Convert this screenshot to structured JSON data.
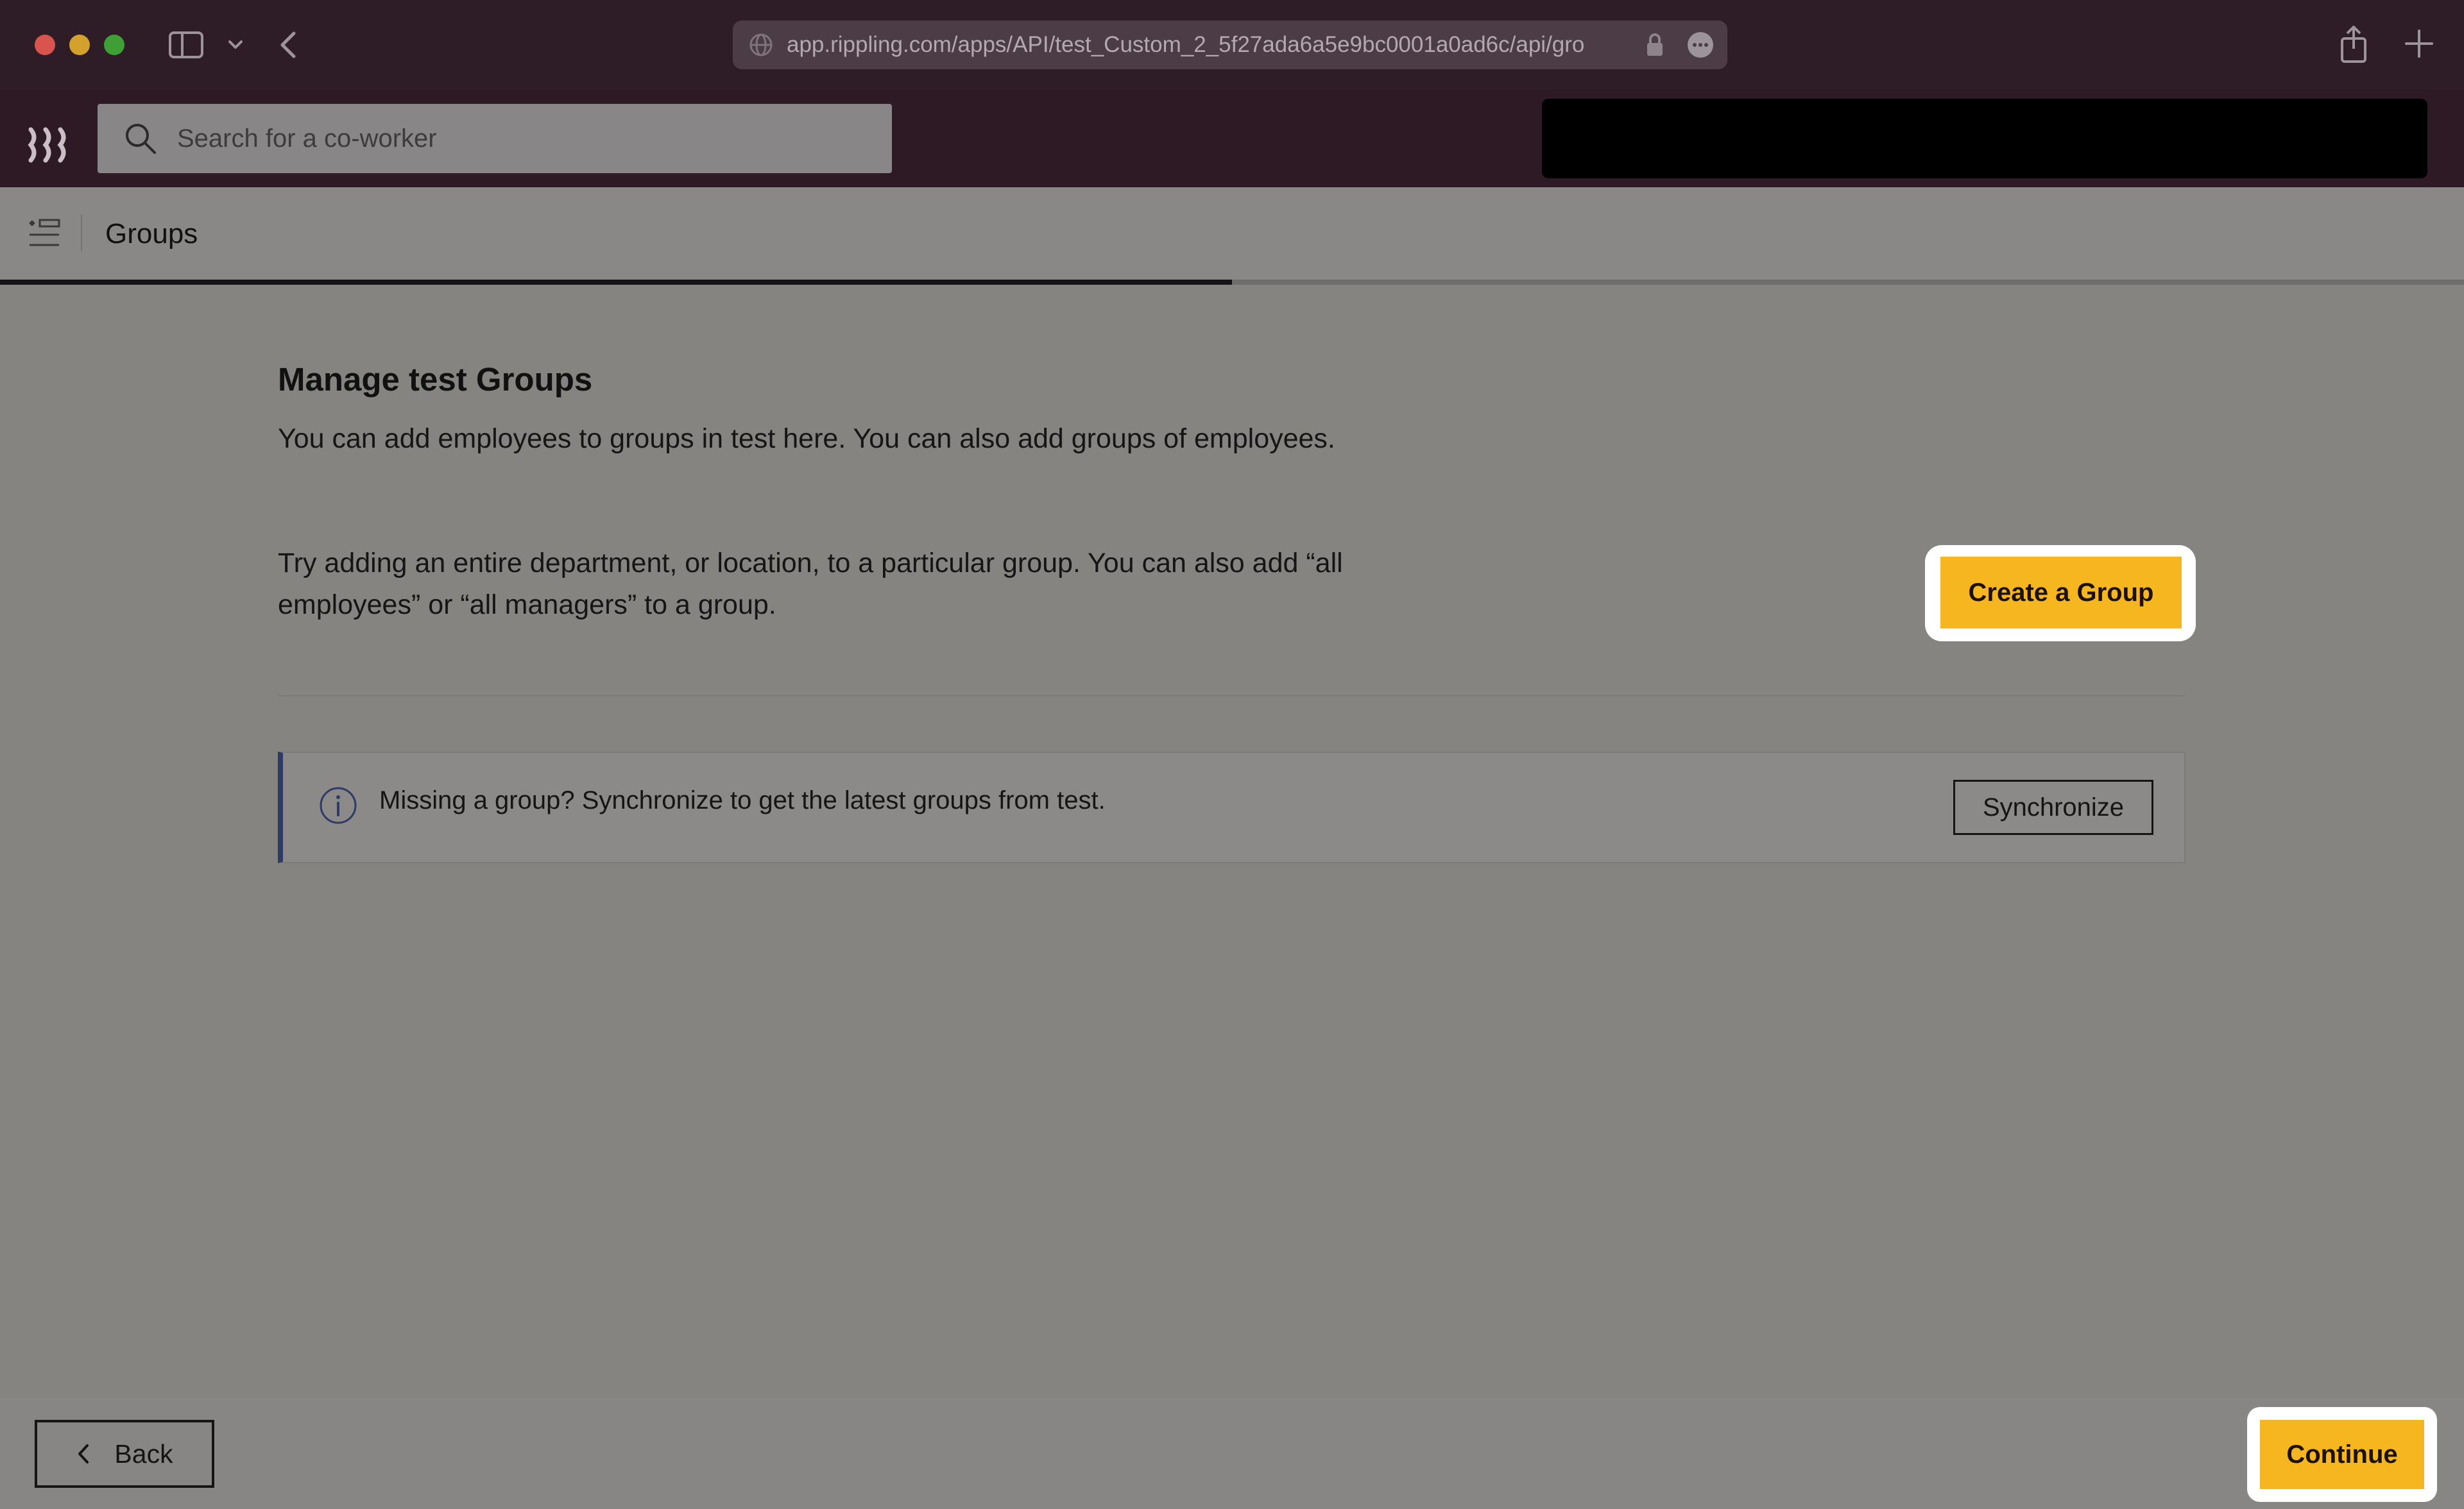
{
  "browser": {
    "url": "app.rippling.com/apps/API/test_Custom_2_5f27ada6a5e9bc0001a0ad6c/api/gro",
    "icons": [
      "sidebar-toggle-icon",
      "chevron-down-icon",
      "back-arrow-icon",
      "globe-icon",
      "lock-icon",
      "more-icon",
      "share-icon",
      "plus-icon"
    ]
  },
  "header": {
    "search_placeholder": "Search for a co-worker",
    "logo_icon": "rippling-logo-icon"
  },
  "subheader": {
    "title": "Groups",
    "progress": 0.5
  },
  "main": {
    "heading": "Manage test Groups",
    "paragraph_1": "You can add employees to groups in test here. You can also add groups of employees.",
    "paragraph_2": "Try adding an entire department, or location, to a particular group. You can also add “all employees” or “all managers” to a group.",
    "create_button": "Create a Group"
  },
  "info": {
    "text": "Missing a group? Synchronize to get the latest groups from test.",
    "sync_button": "Synchronize"
  },
  "footer": {
    "back_label": "Back",
    "continue_label": "Continue"
  },
  "colors": {
    "chrome_bg": "#2e1d27",
    "accent_yellow": "#f6b61f",
    "info_border": "#2d3b66",
    "overlay_gray": "#858481"
  }
}
